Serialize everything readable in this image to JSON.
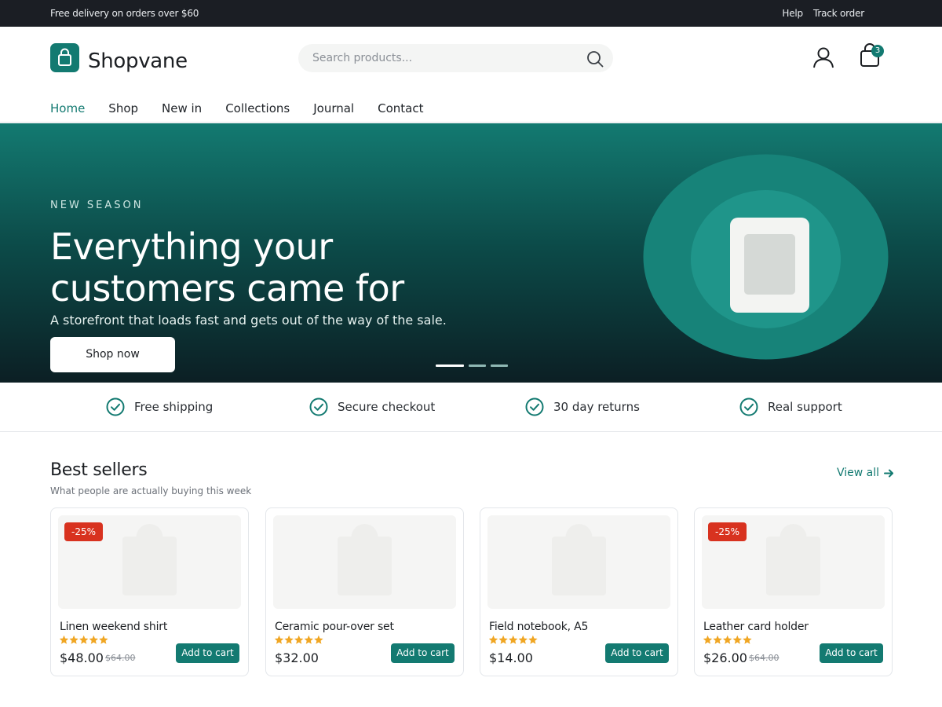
{
  "topbar": {
    "promo": "Free delivery on orders over $60",
    "help": "Help",
    "track_order": "Track order"
  },
  "header": {
    "brand": "Shopvane",
    "search_placeholder": "Search products...",
    "cart_count": "3",
    "icons": {
      "logo": "shopping-bag-icon",
      "search": "search-icon",
      "account": "user-icon",
      "cart": "shopping-bag-icon"
    }
  },
  "nav": {
    "items": [
      {
        "label": "Home",
        "active": true
      },
      {
        "label": "Shop",
        "active": false
      },
      {
        "label": "New in",
        "active": false
      },
      {
        "label": "Collections",
        "active": false
      },
      {
        "label": "Journal",
        "active": false
      },
      {
        "label": "Contact",
        "active": false
      }
    ]
  },
  "hero": {
    "eyebrow": "NEW SEASON",
    "title": "Everything your customers came for",
    "subtitle": "A storefront that loads fast and gets out of the way of the sale.",
    "cta": "Shop now",
    "slides_total": 3,
    "active_slide": 1
  },
  "features": [
    {
      "label": "Free shipping",
      "icon": "check-circle-icon"
    },
    {
      "label": "Secure checkout",
      "icon": "check-circle-icon"
    },
    {
      "label": "30 day returns",
      "icon": "check-circle-icon"
    },
    {
      "label": "Real support",
      "icon": "check-circle-icon"
    }
  ],
  "best_sellers": {
    "title": "Best sellers",
    "subtitle": "What people are actually buying this week",
    "view_all": "View all",
    "products": [
      {
        "name": "Linen weekend shirt",
        "price": "$48.00",
        "old_price": "$64.00",
        "badge": "-25%",
        "rating": 5,
        "button": "Add to cart"
      },
      {
        "name": "Ceramic pour-over set",
        "price": "$32.00",
        "old_price": "",
        "badge": "",
        "rating": 5,
        "button": "Add to cart"
      },
      {
        "name": "Field notebook, A5",
        "price": "$14.00",
        "old_price": "",
        "badge": "",
        "rating": 5,
        "button": "Add to cart"
      },
      {
        "name": "Leather card holder",
        "price": "$26.00",
        "old_price": "$64.00",
        "badge": "-25%",
        "rating": 5,
        "button": "Add to cart"
      }
    ]
  },
  "colors": {
    "accent": "#137a71",
    "topbar": "#1b1e24",
    "sale_badge": "#d8321f",
    "star": "#f0a623"
  }
}
